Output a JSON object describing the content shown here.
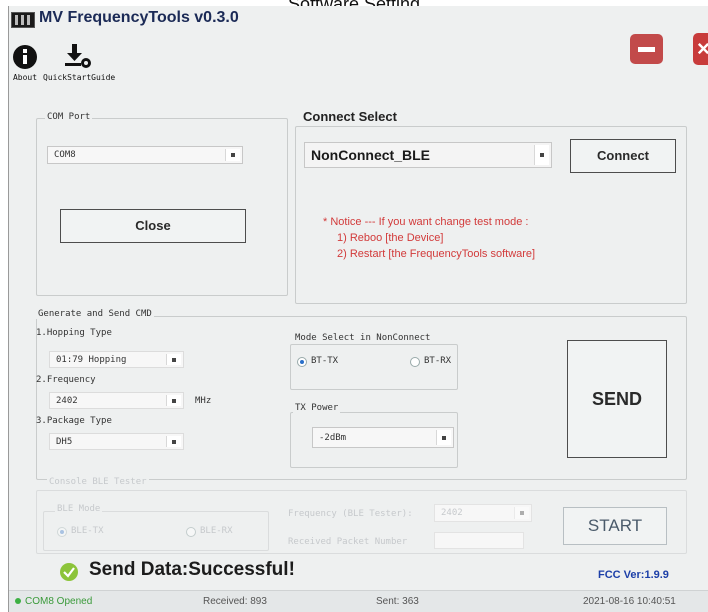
{
  "document_heading": "Software Setting",
  "app": {
    "title": "MV FrequencyTools v0.3.0"
  },
  "toolbar": {
    "about_label": "About",
    "quickstart_label": "QuickStartGuide"
  },
  "com_port": {
    "legend": "COM Port",
    "selected": "COM8",
    "close_label": "Close"
  },
  "connect_select": {
    "legend": "Connect Select",
    "selected": "NonConnect_BLE",
    "connect_label": "Connect",
    "notice_line1": "* Notice --- If you want change test mode :",
    "notice_line2": "1) Reboo [the Device]",
    "notice_line3": "2) Restart [the FrequencyTools software]"
  },
  "generate": {
    "legend": "Generate and Send CMD",
    "hopping_label": "1.Hopping Type",
    "hopping_value": "01:79 Hopping",
    "frequency_label": "2.Frequency",
    "frequency_value": "2402",
    "frequency_unit": "MHz",
    "package_label": "3.Package Type",
    "package_value": "DH5",
    "mode_legend": "Mode Select in NonConnect",
    "mode_options": [
      "BT-TX",
      "BT-RX"
    ],
    "mode_selected": "BT-TX",
    "tx_power_legend": "TX Power",
    "tx_power_value": "-2dBm",
    "send_label": "SEND"
  },
  "ble_tester": {
    "legend": "Console BLE Tester",
    "mode_legend": "BLE Mode",
    "mode_options": [
      "BLE-TX",
      "BLE-RX"
    ],
    "mode_selected": "BLE-TX",
    "frequency_label": "Frequency (BLE Tester):",
    "frequency_value": "2402",
    "received_packet_label": "Received Packet Number",
    "start_label": "START"
  },
  "result": {
    "message": "Send Data:Successful!",
    "fcc_version": "FCC Ver:1.9.9"
  },
  "status": {
    "port": "COM8 Opened",
    "received": "Received: 893",
    "sent": "Sent: 363",
    "datetime": "2021-08-16 10:40:51"
  },
  "colors": {
    "title_text": "#1b2a56",
    "notice": "#d23a3a",
    "success": "#8cc43a",
    "fcc_text": "#1c3fa8",
    "close_button": "#c83b3b"
  }
}
